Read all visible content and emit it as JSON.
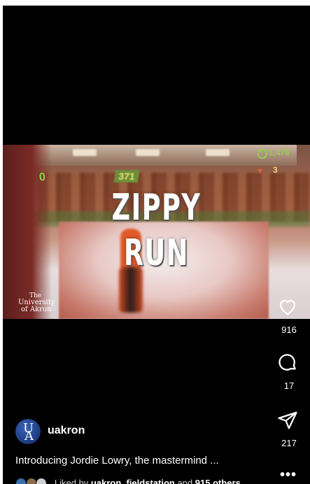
{
  "video": {
    "title_line1": "ZIPPY",
    "title_line2": "RUN",
    "hud": {
      "score_top": "371",
      "coins": "1,476",
      "lives": "3",
      "left_counter": "0"
    },
    "logo": {
      "the": "The",
      "university": "University",
      "of_akron": "of Akron"
    }
  },
  "actions": {
    "likes": "916",
    "comments": "17",
    "shares": "217"
  },
  "post": {
    "username": "uakron",
    "caption": "Introducing Jordie Lowry, the mastermind ...",
    "liked_by_prefix": "Liked by ",
    "liked_by_users": "uakron_fieldstation",
    "liked_by_suffix": " and ",
    "liked_by_others": "915 others"
  },
  "colors": {
    "background": "#000000",
    "text": "#ffffff",
    "avatar": "#2a4f9e"
  },
  "icons": [
    "heart-icon",
    "comment-icon",
    "share-icon",
    "more-icon"
  ]
}
